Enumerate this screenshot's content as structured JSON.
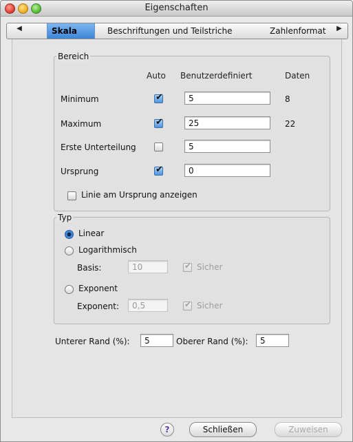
{
  "window": {
    "title": "Eigenschaften"
  },
  "tabs": [
    {
      "label": "Skala"
    },
    {
      "label": "Beschriftungen und Teilstriche"
    },
    {
      "label": "Zahlenformat"
    }
  ],
  "bereich": {
    "title": "Bereich",
    "headers": {
      "auto": "Auto",
      "custom": "Benutzerdefiniert",
      "data": "Daten"
    },
    "rows": [
      {
        "label": "Minimum",
        "auto": true,
        "value": "5",
        "data": "8"
      },
      {
        "label": "Maximum",
        "auto": true,
        "value": "25",
        "data": "22"
      },
      {
        "label": "Erste Unterteilung",
        "auto": false,
        "value": "5",
        "data": ""
      },
      {
        "label": "Ursprung",
        "auto": true,
        "value": "0",
        "data": ""
      }
    ],
    "show_origin_line_label": "Linie am Ursprung anzeigen",
    "show_origin_line": false
  },
  "typ": {
    "title": "Typ",
    "linear_label": "Linear",
    "log_label": "Logarithmisch",
    "basis_label": "Basis:",
    "basis_value": "10",
    "sicher_label": "Sicher",
    "exponent_radio_label": "Exponent",
    "exponent_label": "Exponent:",
    "exponent_value": "0,5",
    "selected": "Linear"
  },
  "margins": {
    "lower_label": "Unterer Rand (%):",
    "lower_value": "5",
    "upper_label": "Oberer Rand (%):",
    "upper_value": "5"
  },
  "footer": {
    "help_label": "?",
    "close_label": "Schließen",
    "apply_label": "Zuweisen"
  }
}
